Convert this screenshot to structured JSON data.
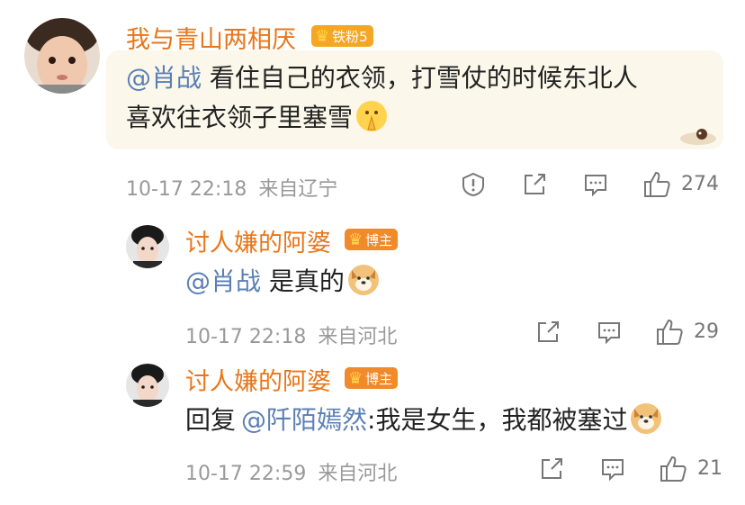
{
  "comments": [
    {
      "username": "我与青山两相厌",
      "badge": "铁粉5",
      "mention": "@肖战",
      "line1": " 看住自己的衣领，打雪仗的时候东北人",
      "line2": "喜欢往衣领子里塞雪",
      "emoji": "pray-emoji",
      "time": "10-17 22:18",
      "location": "来自辽宁",
      "likes": "274"
    },
    {
      "username": "讨人嫌的阿婆",
      "badge": "博主",
      "mention": "@肖战",
      "text": " 是真的",
      "emoji": "dog-emoji",
      "time": "10-17 22:18",
      "location": "来自河北",
      "likes": "29"
    },
    {
      "username": "讨人嫌的阿婆",
      "badge": "博主",
      "prefix": "回复",
      "mention": "@阡陌嫣然",
      "text": ":我是女生，我都被塞过",
      "emoji": "dog-emoji",
      "time": "10-17 22:59",
      "location": "来自河北",
      "likes": "21"
    }
  ],
  "colors": {
    "username": "#e8761a",
    "mention": "#5b7fb5",
    "badge_fan": "#f5a623",
    "badge_host": "#f08a2b",
    "highlight_bg": "#fbf7ea"
  }
}
